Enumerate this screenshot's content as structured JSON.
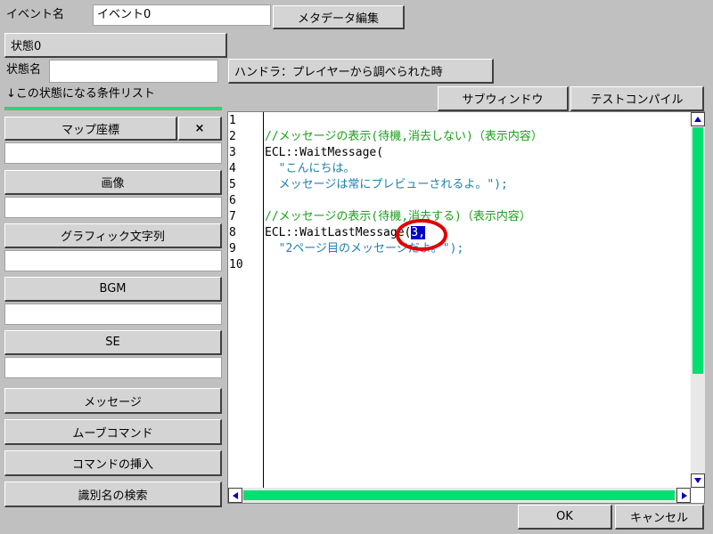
{
  "header": {
    "event_name_label": "イベント名",
    "event_name_value": "イベント0",
    "metadata_button": "メタデータ編集",
    "state_button": "状態0",
    "state_name_label": "状態名",
    "state_name_value": "",
    "handler_button": "ハンドラ：プレイヤーから調べられた時",
    "condition_list_label": "↓この状態になる条件リスト",
    "subwindow_button": "サブウィンドウ",
    "test_compile_button": "テストコンパイル"
  },
  "sidebar": {
    "map_coords_button": "マップ座標",
    "close_label": "×",
    "image_button": "画像",
    "graphic_text_button": "グラフィック文字列",
    "bgm_button": "BGM",
    "se_button": "SE",
    "message_button": "メッセージ",
    "move_command_button": "ムーブコマンド",
    "insert_command_button": "コマンドの挿入",
    "search_id_button": "識別名の検索"
  },
  "editor": {
    "line_numbers": [
      "1",
      "2",
      "3",
      "4",
      "5",
      "6",
      "7",
      "8",
      "9",
      "10"
    ],
    "lines": {
      "l2": "//メッセージの表示(待機,消去しない)（表示内容）",
      "l3": "ECL::WaitMessage(",
      "l4": "  \"こんにちは。",
      "l5": "  メッセージは常にプレビューされるよ。\");",
      "l7": "//メッセージの表示(待機,消去する)（表示内容）",
      "l8_prefix": "ECL::WaitLastMessage(",
      "l8_selected": "3,",
      "l9": "  \"2ページ目のメッセージだよ。\");"
    }
  },
  "footer": {
    "ok_button": "OK",
    "cancel_button": "キャンセル"
  },
  "colors": {
    "comment": "#1aa01a",
    "string": "#1f7fb0",
    "selection": "#0000c8",
    "scrollbar": "#00e070",
    "annotation_circle": "#e00000"
  }
}
